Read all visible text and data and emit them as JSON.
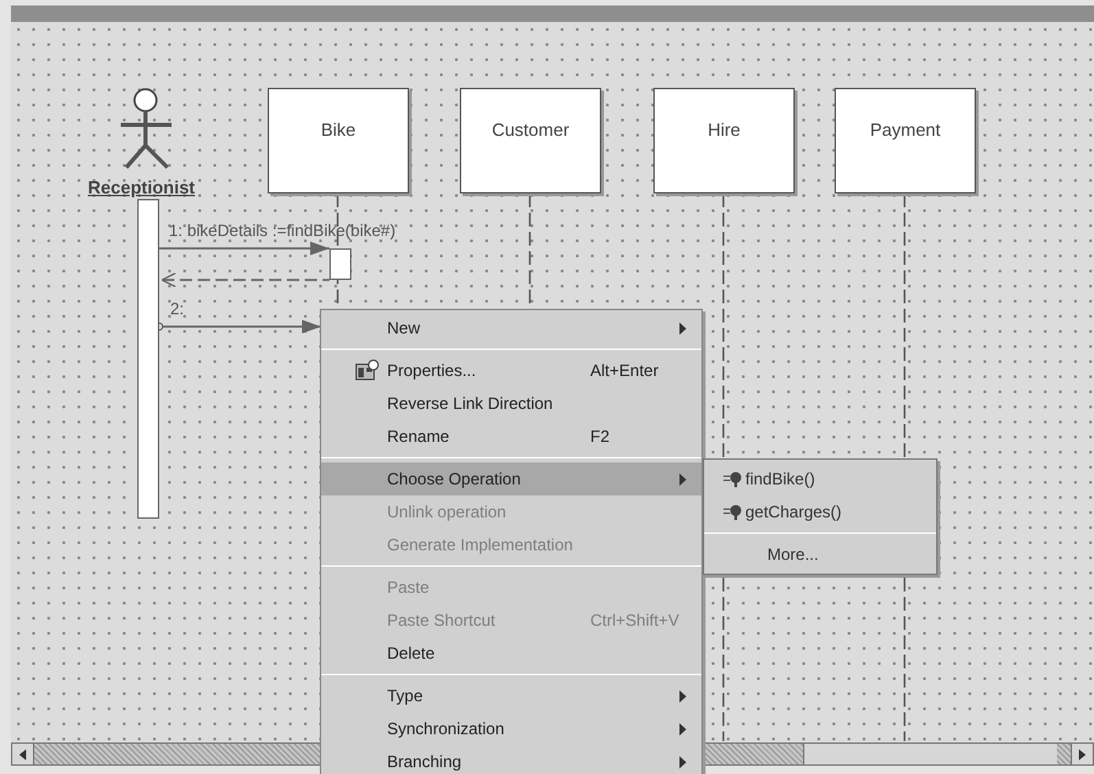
{
  "actor": {
    "name": "Receptionist"
  },
  "objects": [
    {
      "name": "Bike"
    },
    {
      "name": "Customer"
    },
    {
      "name": "Hire"
    },
    {
      "name": "Payment"
    }
  ],
  "messages": [
    {
      "label": "1: bikeDetails :=findBike(bike#)"
    },
    {
      "label": "2:"
    }
  ],
  "context_menu": {
    "items": [
      {
        "kind": "item",
        "label": "New",
        "submenu": true,
        "disabled": false,
        "selected": false
      },
      {
        "kind": "separator"
      },
      {
        "kind": "item",
        "label": "Properties...",
        "shortcut": "Alt+Enter",
        "icon": true,
        "disabled": false,
        "selected": false
      },
      {
        "kind": "item",
        "label": "Reverse Link Direction",
        "disabled": false,
        "selected": false
      },
      {
        "kind": "item",
        "label": "Rename",
        "shortcut": "F2",
        "disabled": false,
        "selected": false
      },
      {
        "kind": "separator"
      },
      {
        "kind": "item",
        "label": "Choose Operation",
        "submenu": true,
        "disabled": false,
        "selected": true
      },
      {
        "kind": "item",
        "label": "Unlink operation",
        "disabled": true,
        "selected": false
      },
      {
        "kind": "item",
        "label": "Generate Implementation",
        "disabled": true,
        "selected": false
      },
      {
        "kind": "separator"
      },
      {
        "kind": "item",
        "label": "Paste",
        "disabled": true,
        "selected": false
      },
      {
        "kind": "item",
        "label": "Paste Shortcut",
        "shortcut": "Ctrl+Shift+V",
        "disabled": true,
        "selected": false
      },
      {
        "kind": "item",
        "label": "Delete",
        "disabled": false,
        "selected": false
      },
      {
        "kind": "separator"
      },
      {
        "kind": "item",
        "label": "Type",
        "submenu": true,
        "disabled": false,
        "selected": false
      },
      {
        "kind": "item",
        "label": "Synchronization",
        "submenu": true,
        "disabled": false,
        "selected": false
      },
      {
        "kind": "item",
        "label": "Branching",
        "submenu": true,
        "disabled": false,
        "selected": false
      }
    ]
  },
  "submenu": {
    "items": [
      {
        "kind": "operation",
        "label": "findBike()"
      },
      {
        "kind": "operation",
        "label": "getCharges()"
      },
      {
        "kind": "separator"
      },
      {
        "kind": "more",
        "label": "More..."
      }
    ]
  }
}
